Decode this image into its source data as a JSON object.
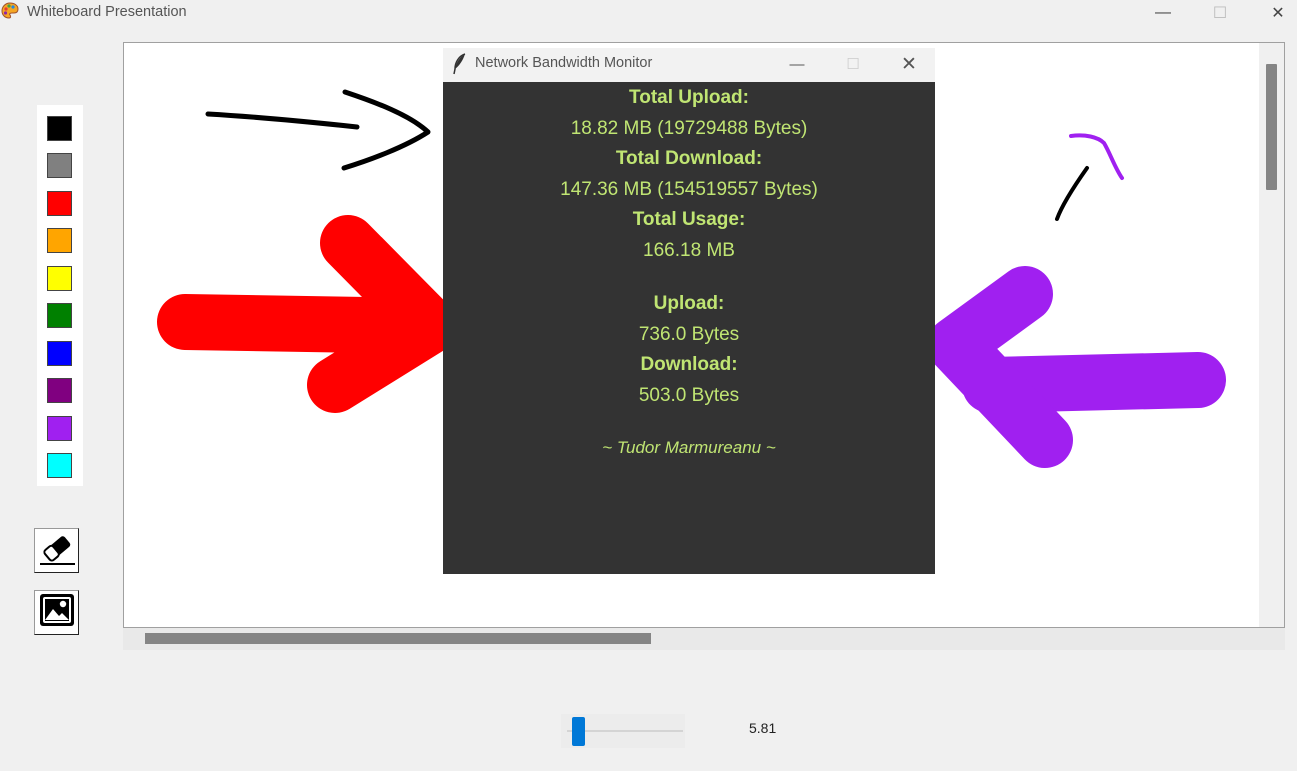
{
  "window": {
    "title": "Whiteboard Presentation",
    "icon": "palette-icon",
    "controls": {
      "minimize": "—",
      "maximize": "☐",
      "close": "✕"
    }
  },
  "palette": {
    "colors": [
      "#000000",
      "#808080",
      "#ff0000",
      "#ffa500",
      "#ffff00",
      "#008000",
      "#0000ff",
      "#800080",
      "#a020f0",
      "#00ffff"
    ]
  },
  "tools": [
    {
      "name": "eraser",
      "icon": "eraser-icon"
    },
    {
      "name": "image",
      "icon": "image-icon"
    }
  ],
  "monitor": {
    "title": "Network Bandwidth Monitor",
    "icon": "feather-icon",
    "controls": {
      "minimize": "—",
      "maximize": "☐",
      "close": "✕"
    },
    "total_upload_label": "Total Upload:",
    "total_upload_value": "18.82 MB (19729488 Bytes)",
    "total_download_label": "Total Download:",
    "total_download_value": "147.36 MB (154519557 Bytes)",
    "total_usage_label": "Total Usage:",
    "total_usage_value": "166.18 MB",
    "upload_label": "Upload:",
    "upload_value": "736.0 Bytes",
    "download_label": "Download:",
    "download_value": "503.0 Bytes",
    "signature": "~ Tudor Marmureanu ~",
    "text_color": "#c0e573",
    "background_color": "#333333"
  },
  "slider": {
    "value": "5.81",
    "position_fraction": 0.05,
    "accent": "#0078d7"
  },
  "drawing": {
    "strokes": [
      {
        "color": "#000000",
        "description": "thin arrow"
      },
      {
        "color": "#ff0000",
        "description": "thick arrow"
      },
      {
        "color": "#a020f0",
        "description": "thick arrow"
      },
      {
        "color": "#000000",
        "description": "small line"
      },
      {
        "color": "#a020f0",
        "description": "small hook"
      }
    ]
  }
}
